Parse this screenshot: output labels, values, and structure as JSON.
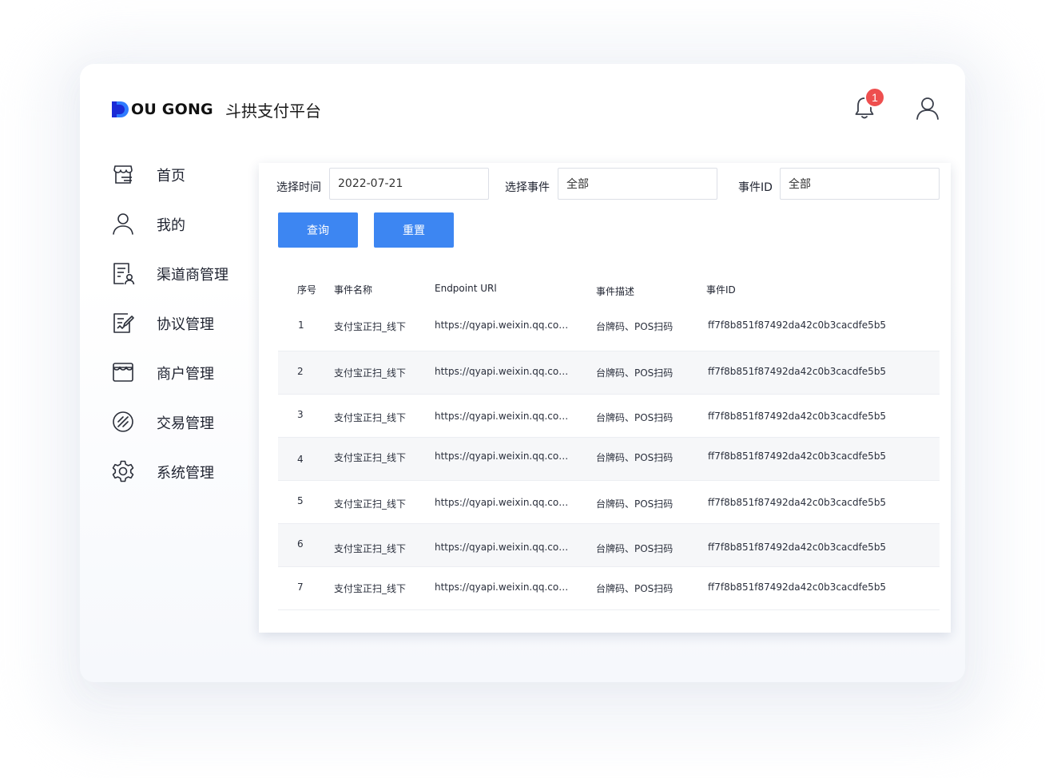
{
  "header": {
    "logo_text": "OU GONG",
    "platform_name": "斗拱支付平台",
    "notification_count": "1"
  },
  "sidebar": {
    "items": [
      {
        "label": "首页",
        "icon": "storefront-home-icon"
      },
      {
        "label": "我的",
        "icon": "user-icon"
      },
      {
        "label": "渠道商管理",
        "icon": "document-user-icon"
      },
      {
        "label": "协议管理",
        "icon": "agreement-edit-icon"
      },
      {
        "label": "商户管理",
        "icon": "shop-icon"
      },
      {
        "label": "交易管理",
        "icon": "transaction-circle-icon"
      },
      {
        "label": "系统管理",
        "icon": "gear-icon"
      }
    ]
  },
  "filters": {
    "time_label": "选择时间",
    "time_value": "2022-07-21",
    "event_label": "选择事件",
    "event_value": "全部",
    "event_id_label": "事件ID",
    "event_id_value": "全部"
  },
  "buttons": {
    "query": "查询",
    "reset": "重置"
  },
  "table": {
    "headers": [
      "序号",
      "事件名称",
      "Endpoint URl",
      "事件描述",
      "事件ID"
    ],
    "rows": [
      {
        "no": "1",
        "name": "支付宝正扫_线下",
        "endpoint": "https://qyapi.weixin.qq.com/…",
        "desc": "台牌码、POS扫码",
        "id": "ff7f8b851f87492da42c0b3cacdfe5b5"
      },
      {
        "no": "2",
        "name": "支付宝正扫_线下",
        "endpoint": "https://qyapi.weixin.qq.com/…",
        "desc": "台牌码、POS扫码",
        "id": "ff7f8b851f87492da42c0b3cacdfe5b5"
      },
      {
        "no": "3",
        "name": "支付宝正扫_线下",
        "endpoint": "https://qyapi.weixin.qq.com/…",
        "desc": "台牌码、POS扫码",
        "id": "ff7f8b851f87492da42c0b3cacdfe5b5"
      },
      {
        "no": "4",
        "name": "支付宝正扫_线下",
        "endpoint": "https://qyapi.weixin.qq.com/…",
        "desc": "台牌码、POS扫码",
        "id": "ff7f8b851f87492da42c0b3cacdfe5b5"
      },
      {
        "no": "5",
        "name": "支付宝正扫_线下",
        "endpoint": "https://qyapi.weixin.qq.com/…",
        "desc": "台牌码、POS扫码",
        "id": "ff7f8b851f87492da42c0b3cacdfe5b5"
      },
      {
        "no": "6",
        "name": "支付宝正扫_线下",
        "endpoint": "https://qyapi.weixin.qq.com/…",
        "desc": "台牌码、POS扫码",
        "id": "ff7f8b851f87492da42c0b3cacdfe5b5"
      },
      {
        "no": "7",
        "name": "支付宝正扫_线下",
        "endpoint": "https://qyapi.weixin.qq.com/…",
        "desc": "台牌码、POS扫码",
        "id": "ff7f8b851f87492da42c0b3cacdfe5b5"
      }
    ]
  },
  "colors": {
    "primary": "#3d86f2",
    "badge": "#ee4f4f",
    "logo_blue": "#1f5fd6"
  }
}
